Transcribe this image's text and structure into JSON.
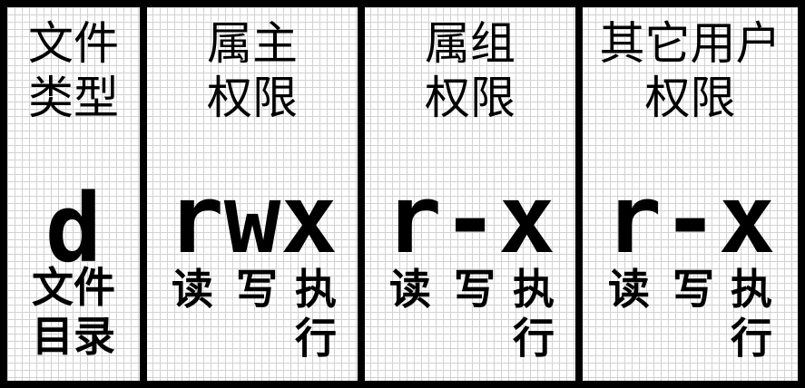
{
  "columns": [
    {
      "header": [
        "文件",
        "类型"
      ],
      "value": "d",
      "notes": [
        "文件",
        "目录"
      ]
    },
    {
      "header": [
        "属主",
        "权限"
      ],
      "value": "rwx",
      "notes": [
        "读",
        "写",
        "执",
        "行"
      ]
    },
    {
      "header": [
        "属组",
        "权限"
      ],
      "value": "r-x",
      "notes": [
        "读",
        "写",
        "执",
        "行"
      ]
    },
    {
      "header": [
        "其它用户",
        "权限"
      ],
      "value": "r-x",
      "notes": [
        "读",
        "写",
        "执",
        "行"
      ]
    }
  ]
}
